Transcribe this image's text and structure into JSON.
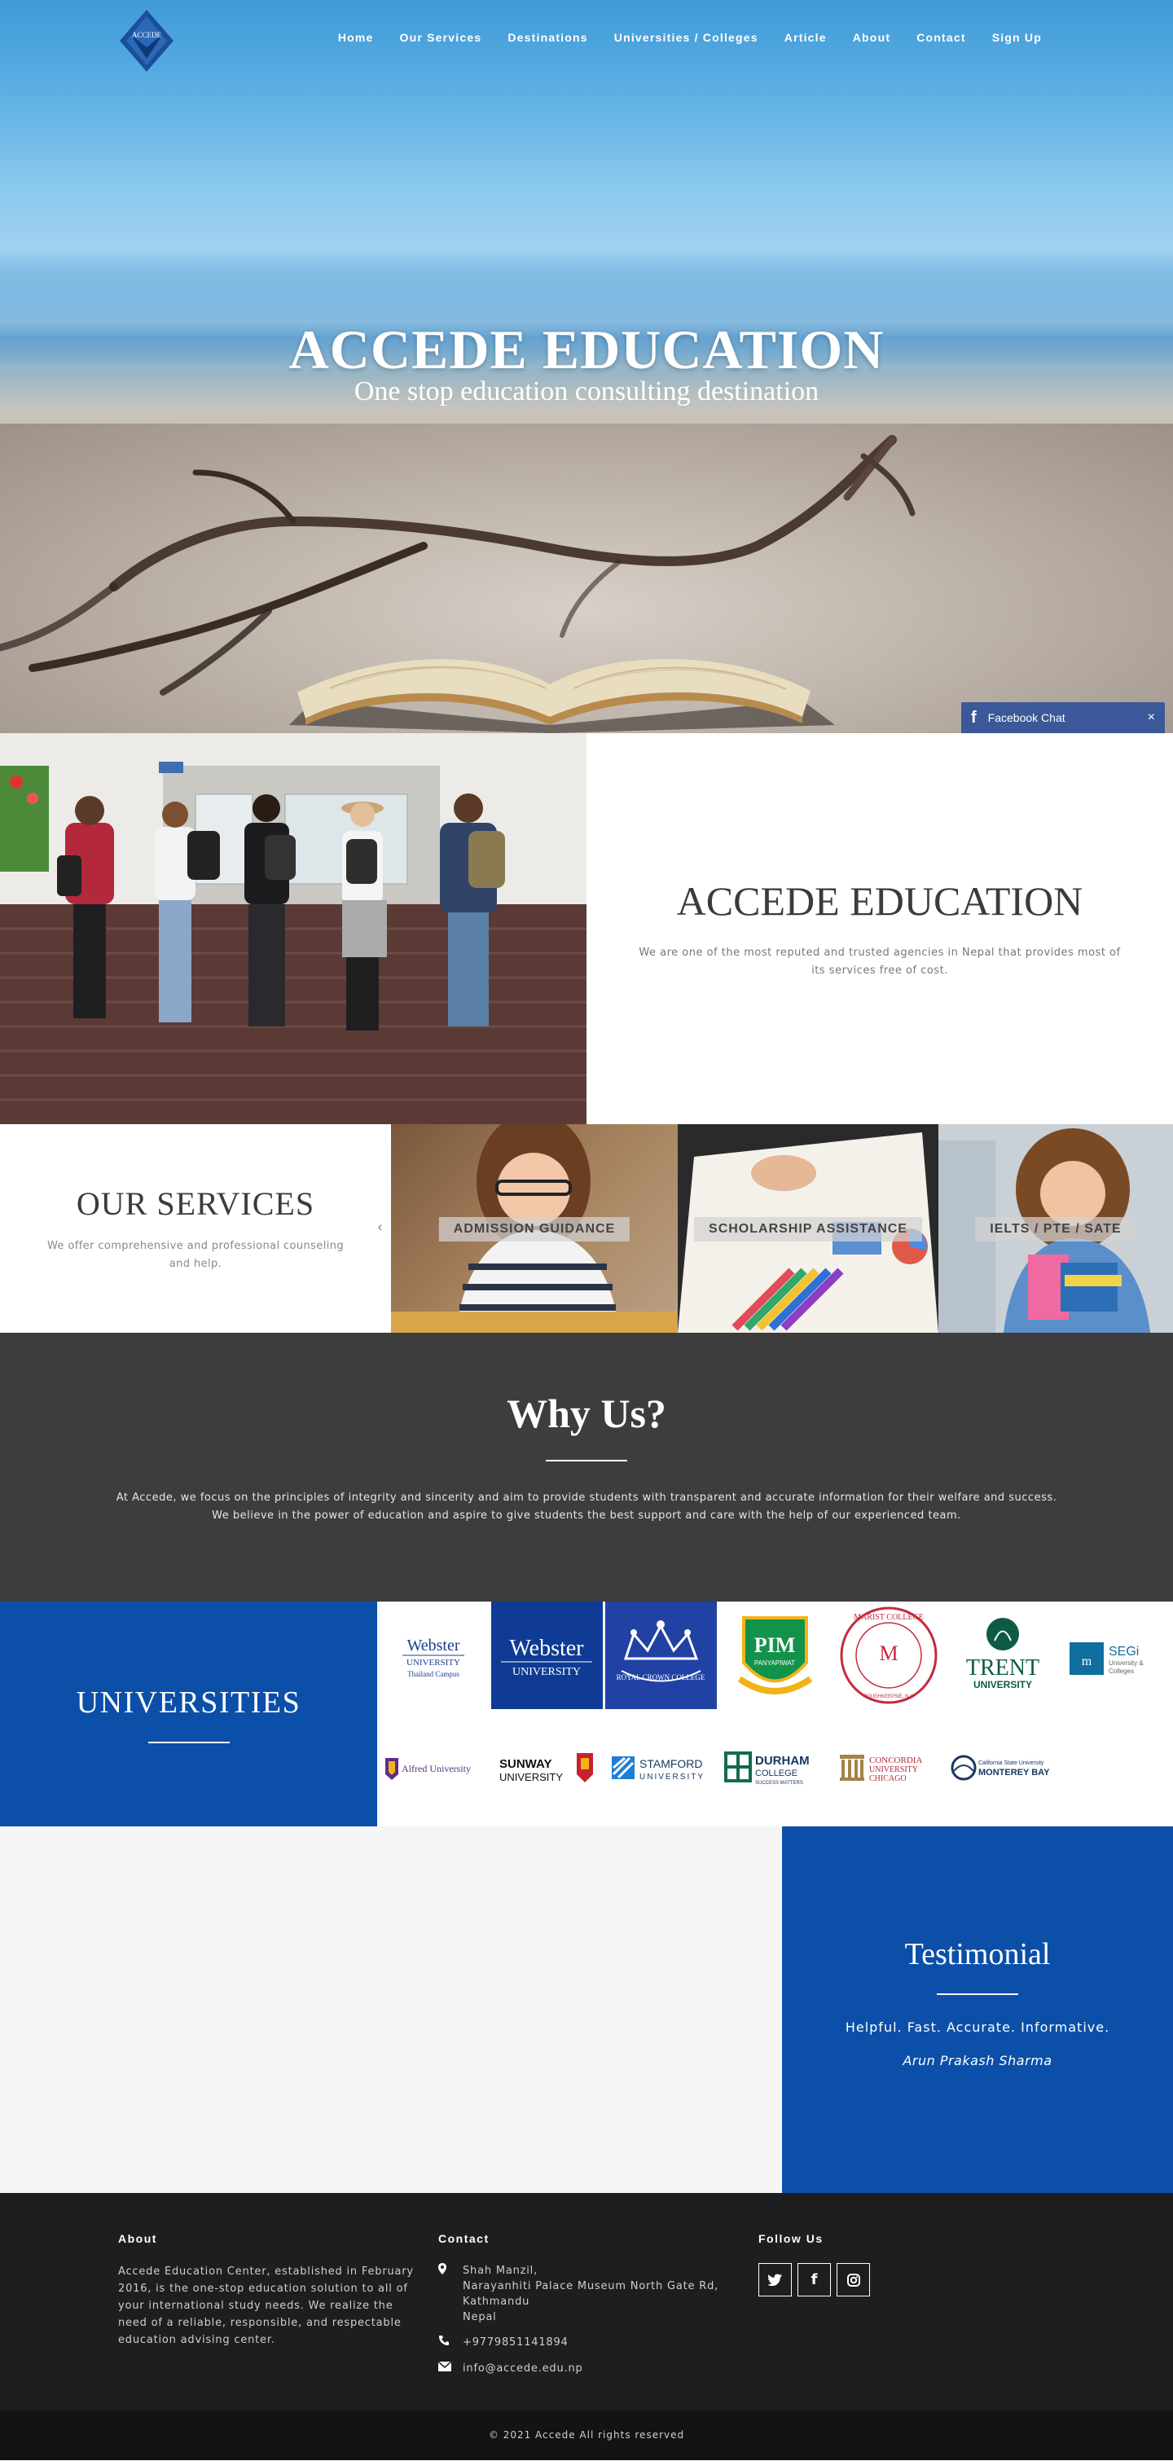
{
  "nav": {
    "logo_text": "ACCEDE",
    "items": [
      "Home",
      "Our Services",
      "Destinations",
      "Universities / Colleges",
      "Article",
      "About",
      "Contact",
      "Sign Up"
    ]
  },
  "hero": {
    "title": "ACCEDE EDUCATION",
    "subtitle": "One stop education consulting destination"
  },
  "fb_chat": {
    "label": "Facebook Chat",
    "close": "×"
  },
  "about": {
    "title": "ACCEDE EDUCATION",
    "text": "We are one of the most reputed and trusted agencies in Nepal that provides most of its services free of cost."
  },
  "services": {
    "title": "OUR SERVICES",
    "text": "We offer comprehensive and professional counseling and help.",
    "arrow": "‹",
    "cards": [
      "ADMISSION GUIDANCE",
      "SCHOLARSHIP ASSISTANCE",
      "IELTS / PTE / SATE"
    ]
  },
  "why": {
    "title": "Why Us?",
    "line1": "At Accede, we focus on the principles of integrity and sincerity and aim to provide students with transparent and accurate information for their welfare and success.",
    "line2": "We believe in the power of education and aspire to give students the best support and care with the help of our experienced team."
  },
  "universities": {
    "title": "UNIVERSITIES",
    "logos": [
      {
        "name": "webster-thailand",
        "l1": "Webster",
        "l2": "UNIVERSITY",
        "l3": "Thailand Campus"
      },
      {
        "name": "webster",
        "l1": "Webster",
        "l2": "UNIVERSITY"
      },
      {
        "name": "royal-crown",
        "l1": "ROYAL CROWN COLLEGE"
      },
      {
        "name": "pim",
        "l1": "PIM",
        "l2": "PANYAPIWAT"
      },
      {
        "name": "marist",
        "l1": "MARIST COLLEGE",
        "l2": "POUGHKEEPSIE, N.Y."
      },
      {
        "name": "trent",
        "l1": "TRENT",
        "l2": "UNIVERSITY"
      },
      {
        "name": "segi",
        "l1": "SEGi",
        "l2": "University &",
        "l3": "Colleges"
      },
      {
        "name": "alfred",
        "l1": "Alfred University"
      },
      {
        "name": "sunway",
        "l1": "SUNWAY",
        "l2": "UNIVERSITY"
      },
      {
        "name": "stamford",
        "l1": "STAMFORD",
        "l2": "UNIVERSITY"
      },
      {
        "name": "durham",
        "l1": "DURHAM",
        "l2": "COLLEGE",
        "l3": "SUCCESS MATTERS"
      },
      {
        "name": "concordia",
        "l1": "CONCORDIA",
        "l2": "UNIVERSITY",
        "l3": "CHICAGO"
      },
      {
        "name": "csumb",
        "l1": "California State University",
        "l2": "MONTEREY BAY"
      }
    ]
  },
  "testimonial": {
    "title": "Testimonial",
    "quote": "Helpful. Fast. Accurate. Informative.",
    "author": "Arun Prakash Sharma"
  },
  "footer": {
    "about_title": "About",
    "about_text": "Accede Education Center, established in February 2016, is the one-stop education solution to all of your international study needs. We realize the need of a reliable, responsible, and respectable education advising center.",
    "contact_title": "Contact",
    "address": [
      "Shah Manzil,",
      "Narayanhiti Palace Museum North Gate Rd,",
      "Kathmandu",
      "Nepal"
    ],
    "phone": "+9779851141894",
    "email": "info@accede.edu.np",
    "follow_title": "Follow Us",
    "copyright": "© 2021 Accede All rights reserved"
  },
  "colors": {
    "brand_blue": "#0b4fa9",
    "dark_section": "#3d3d3d",
    "footer_bg": "#1d1e20"
  }
}
